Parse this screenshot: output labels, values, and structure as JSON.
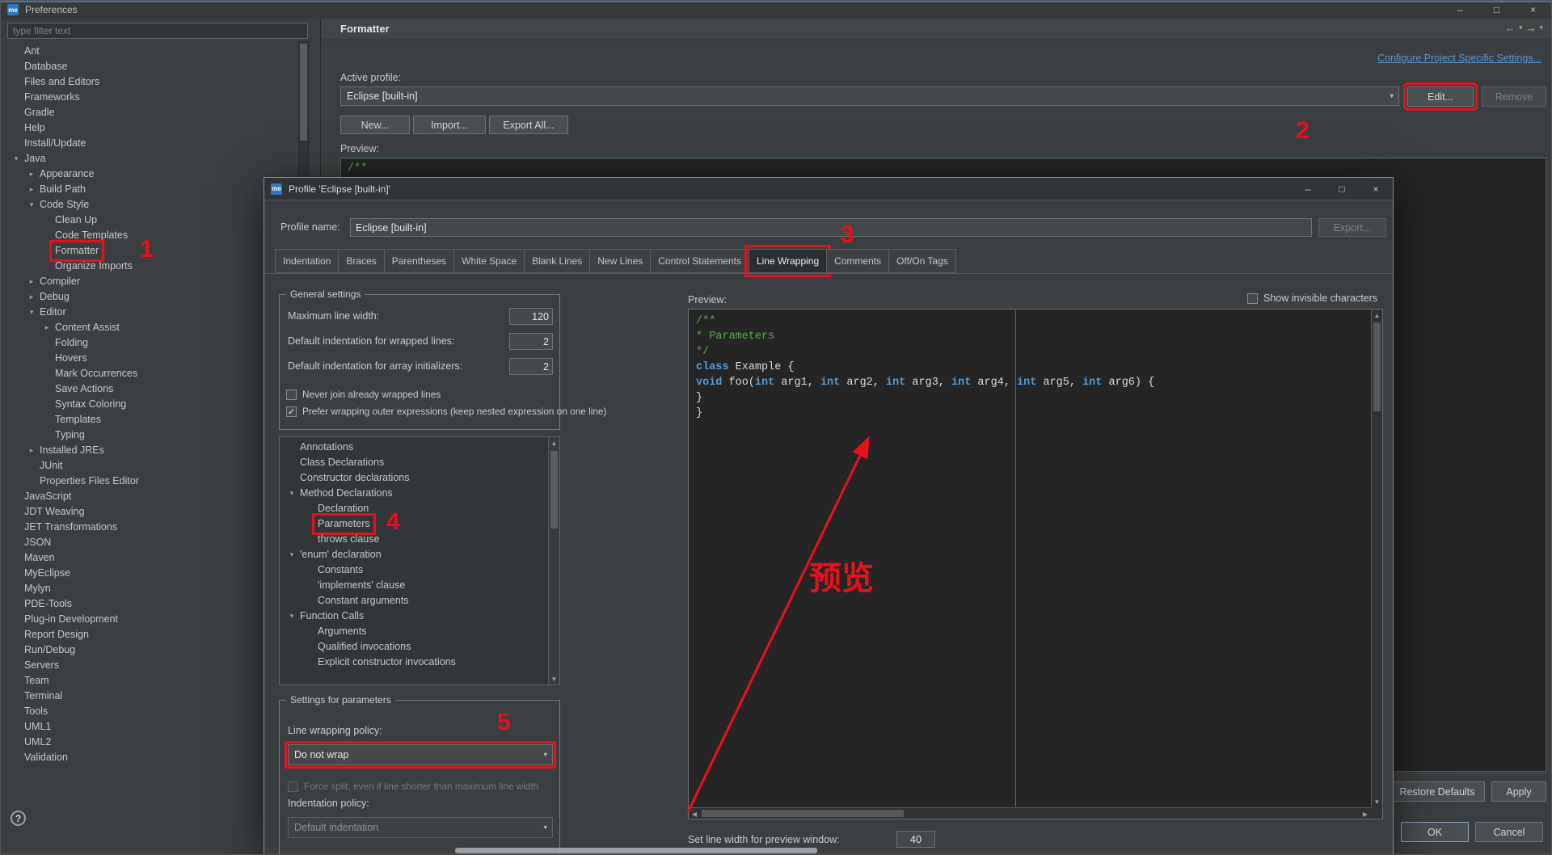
{
  "icons": {
    "app_logo": "me",
    "minimize": "–",
    "maximize": "□",
    "close": "×",
    "back": "←",
    "forward": "→",
    "caret": "▾",
    "help": "?",
    "chev_open": "▾",
    "chev_closed": "▸",
    "check": "✓",
    "up": "▲",
    "down": "▼",
    "left": "◀",
    "right": "▶"
  },
  "window": {
    "title": "Preferences"
  },
  "sidebar": {
    "filter_placeholder": "type filter text",
    "tree": [
      {
        "label": "Ant",
        "level": 0
      },
      {
        "label": "Database",
        "level": 0
      },
      {
        "label": "Files and Editors",
        "level": 0
      },
      {
        "label": "Frameworks",
        "level": 0
      },
      {
        "label": "Gradle",
        "level": 0
      },
      {
        "label": "Help",
        "level": 0
      },
      {
        "label": "Install/Update",
        "level": 0
      },
      {
        "label": "Java",
        "level": 0,
        "ch": "open"
      },
      {
        "label": "Appearance",
        "level": 1,
        "ch": "closed"
      },
      {
        "label": "Build Path",
        "level": 1,
        "ch": "closed"
      },
      {
        "label": "Code Style",
        "level": 1,
        "ch": "open"
      },
      {
        "label": "Clean Up",
        "level": 2
      },
      {
        "label": "Code Templates",
        "level": 2
      },
      {
        "label": "Formatter",
        "level": 2,
        "ring": true,
        "num": "n1"
      },
      {
        "label": "Organize Imports",
        "level": 2
      },
      {
        "label": "Compiler",
        "level": 1,
        "ch": "closed"
      },
      {
        "label": "Debug",
        "level": 1,
        "ch": "closed"
      },
      {
        "label": "Editor",
        "level": 1,
        "ch": "open"
      },
      {
        "label": "Content Assist",
        "level": 2,
        "ch": "closed"
      },
      {
        "label": "Folding",
        "level": 2
      },
      {
        "label": "Hovers",
        "level": 2
      },
      {
        "label": "Mark Occurrences",
        "level": 2
      },
      {
        "label": "Save Actions",
        "level": 2
      },
      {
        "label": "Syntax Coloring",
        "level": 2
      },
      {
        "label": "Templates",
        "level": 2
      },
      {
        "label": "Typing",
        "level": 2
      },
      {
        "label": "Installed JREs",
        "level": 1,
        "ch": "closed"
      },
      {
        "label": "JUnit",
        "level": 1
      },
      {
        "label": "Properties Files Editor",
        "level": 1
      },
      {
        "label": "JavaScript",
        "level": 0
      },
      {
        "label": "JDT Weaving",
        "level": 0
      },
      {
        "label": "JET Transformations",
        "level": 0
      },
      {
        "label": "JSON",
        "level": 0
      },
      {
        "label": "Maven",
        "level": 0
      },
      {
        "label": "MyEclipse",
        "level": 0
      },
      {
        "label": "Mylyn",
        "level": 0
      },
      {
        "label": "PDE-Tools",
        "level": 0
      },
      {
        "label": "Plug-in Development",
        "level": 0
      },
      {
        "label": "Report Design",
        "level": 0
      },
      {
        "label": "Run/Debug",
        "level": 0
      },
      {
        "label": "Servers",
        "level": 0
      },
      {
        "label": "Team",
        "level": 0
      },
      {
        "label": "Terminal",
        "level": 0
      },
      {
        "label": "Tools",
        "level": 0
      },
      {
        "label": "UML1",
        "level": 0
      },
      {
        "label": "UML2",
        "level": 0
      },
      {
        "label": "Validation",
        "level": 0
      }
    ]
  },
  "main": {
    "header": "Formatter",
    "link": "Configure Project Specific Settings...",
    "active_profile_label": "Active profile:",
    "active_profile_value": "Eclipse [built-in]",
    "edit": "Edit...",
    "remove": "Remove",
    "new": "New...",
    "import": "Import...",
    "export_all": "Export All...",
    "preview_label": "Preview:",
    "preview_code": "/**",
    "restore_defaults": "Restore Defaults",
    "apply": "Apply",
    "ok": "OK",
    "cancel": "Cancel"
  },
  "dialog": {
    "title": "Profile 'Eclipse [built-in]'",
    "profile_name_label": "Profile name:",
    "profile_name_value": "Eclipse [built-in]",
    "export": "Export...",
    "tabs": [
      {
        "label": "Indentation"
      },
      {
        "label": "Braces"
      },
      {
        "label": "Parentheses"
      },
      {
        "label": "White Space"
      },
      {
        "label": "Blank Lines"
      },
      {
        "label": "New Lines"
      },
      {
        "label": "Control Statements"
      },
      {
        "label": "Line Wrapping",
        "sel": true,
        "ring": true,
        "num": "n3"
      },
      {
        "label": "Comments"
      },
      {
        "label": "Off/On Tags"
      }
    ],
    "general": {
      "title": "General settings",
      "fields": [
        {
          "label": "Maximum line width:",
          "value": "120"
        },
        {
          "label": "Default indentation for wrapped lines:",
          "value": "2"
        },
        {
          "label": "Default indentation for array initializers:",
          "value": "2"
        }
      ],
      "checkboxes": [
        {
          "label": "Never join already wrapped lines",
          "checked": false
        },
        {
          "label": "Prefer wrapping outer expressions (keep nested expression on one line)",
          "checked": true
        }
      ]
    },
    "wrap_tree": [
      {
        "label": "Annotations",
        "level": 0
      },
      {
        "label": "Class Declarations",
        "level": 0
      },
      {
        "label": "Constructor declarations",
        "level": 0
      },
      {
        "label": "Method Declarations",
        "level": 0,
        "ch": "open"
      },
      {
        "label": "Declaration",
        "level": 1
      },
      {
        "label": "Parameters",
        "level": 1,
        "ring": true,
        "num": "n4"
      },
      {
        "label": "throws clause",
        "level": 1
      },
      {
        "label": "'enum' declaration",
        "level": 0,
        "ch": "open"
      },
      {
        "label": "Constants",
        "level": 1
      },
      {
        "label": "'implements' clause",
        "level": 1
      },
      {
        "label": "Constant arguments",
        "level": 1
      },
      {
        "label": "Function Calls",
        "level": 0,
        "ch": "open"
      },
      {
        "label": "Arguments",
        "level": 1
      },
      {
        "label": "Qualified invocations",
        "level": 1
      },
      {
        "label": "Explicit constructor invocations",
        "level": 1
      }
    ],
    "settings_group": {
      "title": "Settings for parameters",
      "policy_label": "Line wrapping policy:",
      "policy_value": "Do not wrap",
      "force_split": "Force split, even if line shorter than maximum line width",
      "indent_label": "Indentation policy:",
      "indent_value": "Default indentation"
    },
    "preview": {
      "label": "Preview:",
      "show_invisible": "Show invisible characters",
      "code": [
        [
          {
            "t": "/**",
            "c": "com"
          }
        ],
        [
          {
            "t": " * Parameters",
            "c": "com"
          }
        ],
        [
          {
            "t": " */",
            "c": "com"
          }
        ],
        [
          {
            "t": "class",
            "c": "kw"
          },
          {
            "t": " Example {",
            "c": "pl"
          }
        ],
        [
          {
            "t": "    ",
            "c": "pl"
          },
          {
            "t": "void",
            "c": "kw"
          },
          {
            "t": " foo(",
            "c": "pl"
          },
          {
            "t": "int",
            "c": "kw"
          },
          {
            "t": " arg1, ",
            "c": "pl"
          },
          {
            "t": "int",
            "c": "kw"
          },
          {
            "t": " arg2, ",
            "c": "pl"
          },
          {
            "t": "int",
            "c": "kw"
          },
          {
            "t": " arg3, ",
            "c": "pl"
          },
          {
            "t": "int",
            "c": "kw"
          },
          {
            "t": " arg4, ",
            "c": "pl"
          },
          {
            "t": "int",
            "c": "kw"
          },
          {
            "t": " arg5, ",
            "c": "pl"
          },
          {
            "t": "int",
            "c": "kw"
          },
          {
            "t": " arg6) {",
            "c": "pl"
          }
        ],
        [
          {
            "t": "        }",
            "c": "pl"
          }
        ],
        [
          {
            "t": "}",
            "c": "pl"
          }
        ]
      ],
      "line_width_label": "Set line width for preview window:",
      "line_width_value": "40"
    }
  },
  "annotations": {
    "n1": "1",
    "n2": "2",
    "n3": "3",
    "n4": "4",
    "n5": "5",
    "preview_text": "预览",
    "color": "#e8101c"
  }
}
